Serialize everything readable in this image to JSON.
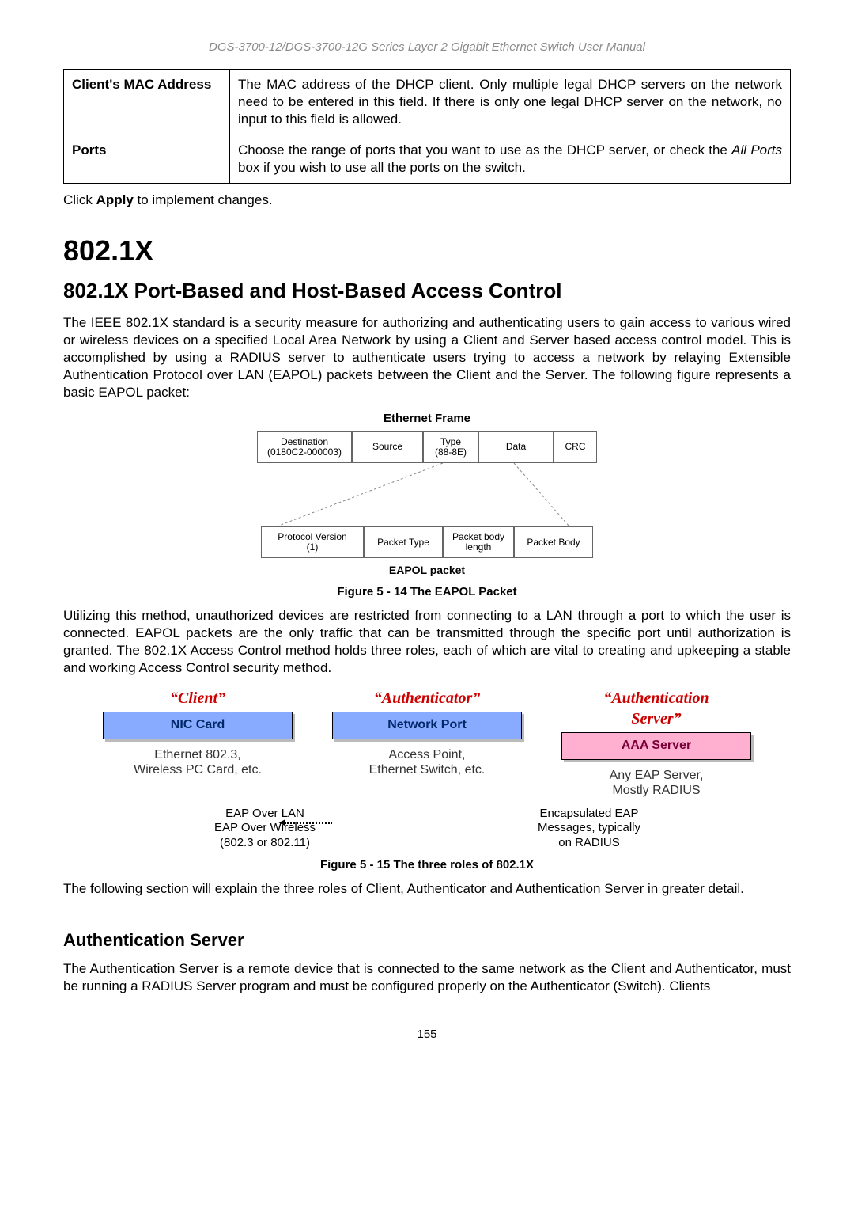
{
  "header": "DGS-3700-12/DGS-3700-12G Series Layer 2 Gigabit Ethernet Switch User Manual",
  "table": {
    "rows": [
      {
        "key": "Client's MAC Address",
        "value": "The MAC address of the DHCP client. Only multiple legal DHCP servers on the network need to be entered in this field. If there is only one legal DHCP server on the network, no input to this field is allowed."
      },
      {
        "key": "Ports",
        "value_pre": "Choose the range of ports that you want to use as the DHCP server, or check the ",
        "value_em": "All Ports",
        "value_post": " box if you wish to use all the ports on the switch."
      }
    ]
  },
  "click_apply": {
    "pre": "Click ",
    "bold": "Apply",
    "post": " to implement changes."
  },
  "h1": "802.1X",
  "h2": "802.1X Port-Based and Host-Based Access Control",
  "para1": "The IEEE 802.1X standard is a security measure for authorizing and authenticating users to gain access to various wired or wireless devices on a specified Local Area Network by using a Client and Server based access control model. This is accomplished by using a RADIUS server to authenticate users trying to access a network by relaying Extensible Authentication Protocol over LAN (EAPOL) packets between the Client and the Server. The following figure represents a basic EAPOL packet:",
  "diagram1": {
    "title_top": "Ethernet Frame",
    "row1": {
      "c1a": "Destination",
      "c1b": "(0180C2-000003)",
      "c2": "Source",
      "c3a": "Type",
      "c3b": "(88-8E)",
      "c4": "Data",
      "c5": "CRC"
    },
    "row2": {
      "c1a": "Protocol Version",
      "c1b": "(1)",
      "c2": "Packet Type",
      "c3a": "Packet body",
      "c3b": "length",
      "c4": "Packet Body"
    },
    "title_bottom": "EAPOL packet"
  },
  "fig1_caption": "Figure 5 - 14 The EAPOL Packet",
  "para2": "Utilizing this method, unauthorized devices are restricted from connecting to a LAN through a port to which the user is connected. EAPOL packets are the only traffic that can be transmitted through the specific port until authorization is granted. The 802.1X Access Control method holds three roles, each of which are vital to creating and upkeeping a stable and working Access Control security method.",
  "diagram2": {
    "roles": {
      "client": "“Client”",
      "auth": "“Authenticator”",
      "server_l1": "“Authentication",
      "server_l2": "Server”"
    },
    "boxes": {
      "nic": "NIC Card",
      "port": "Network Port",
      "aaa": "AAA Server"
    },
    "descs": {
      "nic_l1": "Ethernet 802.3,",
      "nic_l2": "Wireless PC Card, etc.",
      "port_l1": "Access Point,",
      "port_l2": "Ethernet Switch, etc.",
      "aaa_l1": "Any EAP Server,",
      "aaa_l2": "Mostly RADIUS"
    },
    "mid": {
      "left_l1": "EAP Over LAN",
      "left_l2": "EAP Over Wireless",
      "left_l3": "(802.3 or 802.11)",
      "right_l1": "Encapsulated EAP",
      "right_l2": "Messages, typically",
      "right_l3": "on RADIUS"
    }
  },
  "fig2_caption": "Figure 5 - 15 The three roles of 802.1X",
  "para3": "The following section will explain the three roles of Client, Authenticator and Authentication Server in greater detail.",
  "h3": "Authentication Server",
  "para4": "The Authentication Server is a remote device that is connected to the same network as the Client and Authenticator, must be running a RADIUS Server program and must be configured properly on the Authenticator (Switch). Clients",
  "page_number": "155"
}
